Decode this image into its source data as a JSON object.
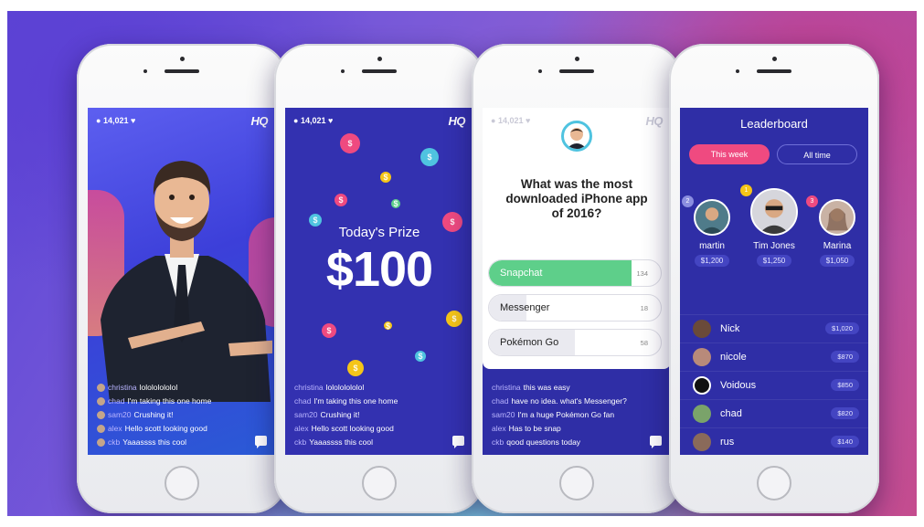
{
  "hq_logo": "HQ",
  "viewers": "14,021",
  "chat_main": [
    {
      "user": "christina",
      "message": "lolololololol"
    },
    {
      "user": "chad",
      "message": "I'm taking this one home"
    },
    {
      "user": "sam20",
      "message": "Crushing it!"
    },
    {
      "user": "alex",
      "message": "Hello scott looking good"
    },
    {
      "user": "ckb",
      "message": "Yaaassss this cool"
    }
  ],
  "prize": {
    "label": "Today's Prize",
    "amount": "$100",
    "coin_symbol": "$"
  },
  "question": {
    "text": "What was the most downloaded iPhone app of 2016?",
    "answers": [
      {
        "label": "Snapchat",
        "count": "134",
        "fraction": 0.83,
        "color": "#5ecf8a"
      },
      {
        "label": "Messenger",
        "count": "18",
        "fraction": 0.22,
        "color": "#eaeaf0"
      },
      {
        "label": "Pokémon Go",
        "count": "58",
        "fraction": 0.5,
        "color": "#eaeaf0"
      }
    ],
    "chat": [
      {
        "user": "christina",
        "message": "this was easy"
      },
      {
        "user": "chad",
        "message": "have no idea. what's Messenger?"
      },
      {
        "user": "sam20",
        "message": "I'm a huge Pokémon Go fan"
      },
      {
        "user": "alex",
        "message": "Has to be snap"
      },
      {
        "user": "ckb",
        "message": "qood questions today"
      }
    ]
  },
  "leaderboard": {
    "title": "Leaderboard",
    "tab_week": "This week",
    "tab_all": "All time",
    "podium": [
      {
        "rank": "2",
        "name": "martin",
        "money": "$1,200",
        "rank_color": "#8b8ee0"
      },
      {
        "rank": "1",
        "name": "Tim Jones",
        "money": "$1,250",
        "rank_color": "#f5c518"
      },
      {
        "rank": "3",
        "name": "Marina",
        "money": "$1,050",
        "rank_color": "#ef4a80"
      }
    ],
    "rows": [
      {
        "name": "Nick",
        "money": "$1,020"
      },
      {
        "name": "nicole",
        "money": "$870"
      },
      {
        "name": "Voidous",
        "money": "$850"
      },
      {
        "name": "chad",
        "money": "$820"
      },
      {
        "name": "rus",
        "money": "$140"
      }
    ]
  },
  "colors": {
    "brand_blue": "#2f2ea6",
    "accent_pink": "#ef4a80",
    "correct_green": "#5ecf8a"
  }
}
